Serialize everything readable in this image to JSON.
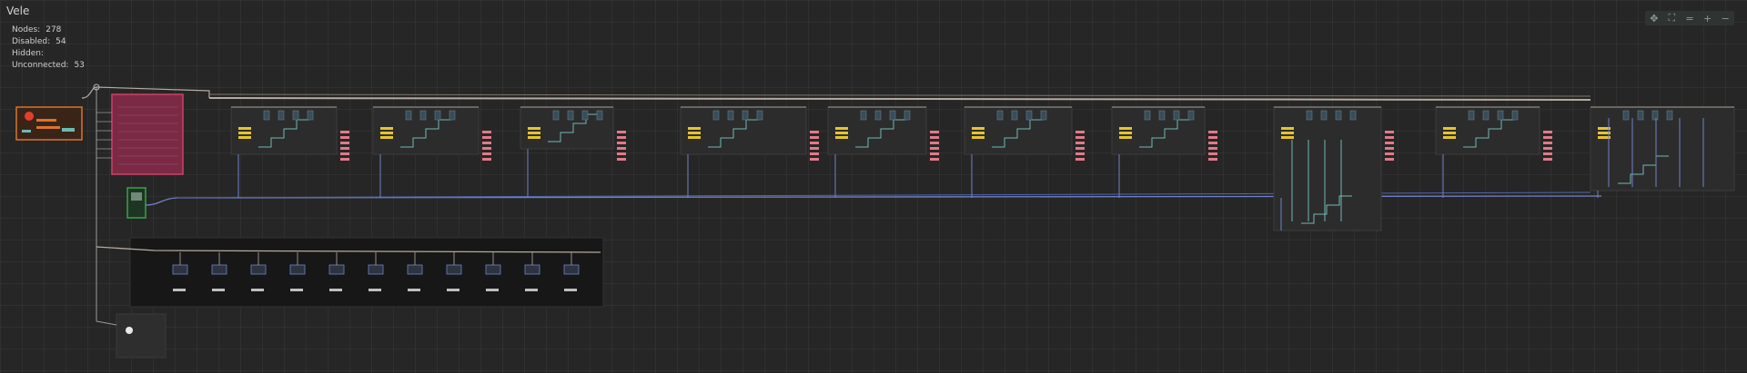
{
  "graph": {
    "title": "Vele"
  },
  "stats": [
    {
      "key": "Nodes:",
      "value": "278"
    },
    {
      "key": "Disabled:",
      "value": "54"
    },
    {
      "key": "Hidden:",
      "value": ""
    },
    {
      "key": "Unconnected:",
      "value": "53"
    }
  ],
  "toolbar": {
    "buttons": [
      {
        "name": "pan-icon",
        "glyph": "✥"
      },
      {
        "name": "fit-view-icon",
        "glyph": "⛶"
      },
      {
        "name": "reset-zoom-icon",
        "glyph": "="
      },
      {
        "name": "zoom-in-icon",
        "glyph": "+"
      },
      {
        "name": "zoom-out-icon",
        "glyph": "−"
      }
    ]
  },
  "colors": {
    "background": "#262626",
    "wire_main": "#b5aba0",
    "wire_blue": "#6f82c9",
    "wire_teal": "#6fb9b3",
    "node_orange": "#d8742f",
    "node_pink": "#d0406a",
    "node_green": "#38a14a",
    "label_yellow": "#e6c42d",
    "label_pink": "#e07a8a"
  }
}
